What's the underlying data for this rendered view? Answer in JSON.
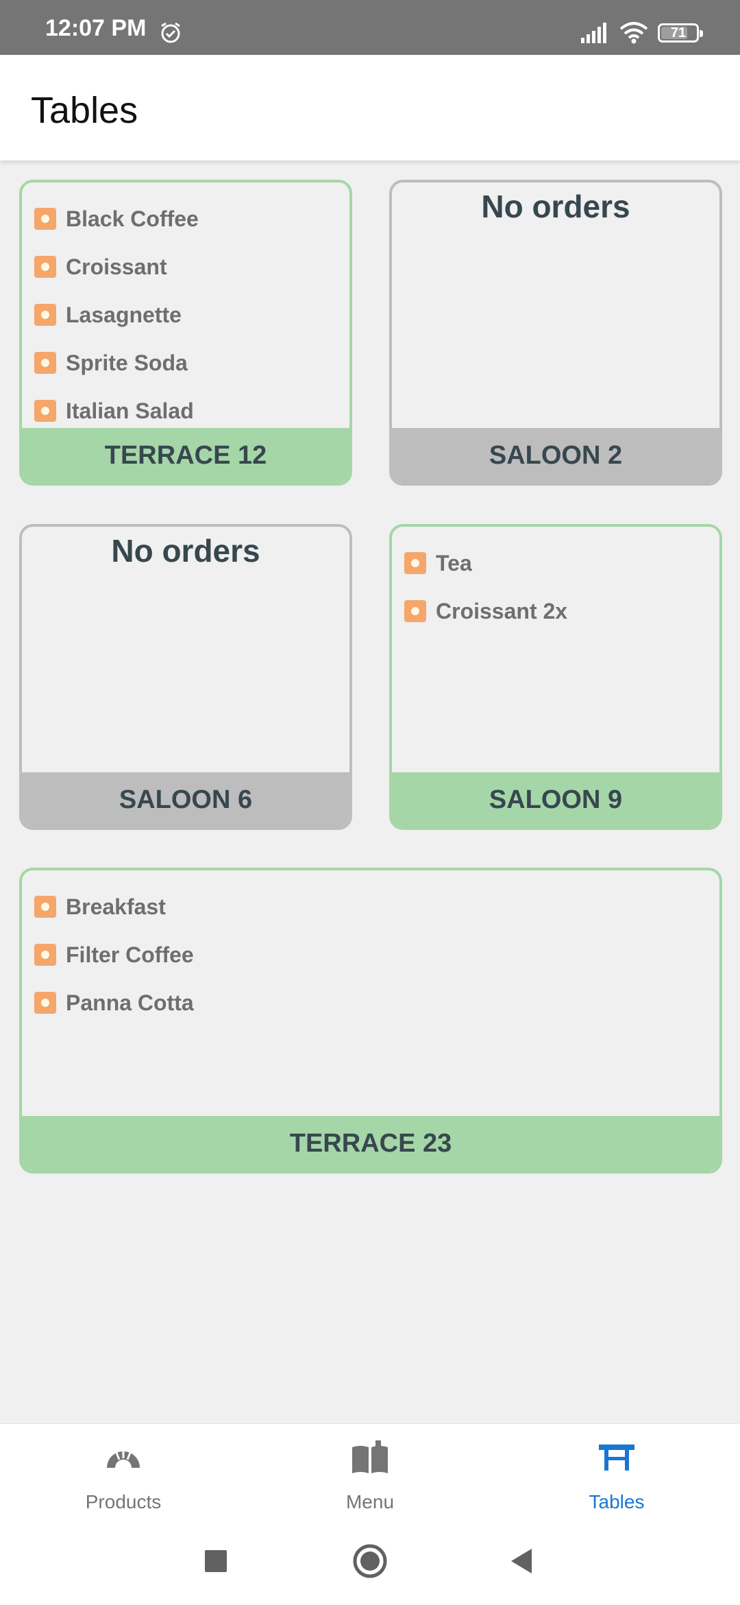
{
  "status_bar": {
    "time": "12:07 PM",
    "battery_level": "71"
  },
  "app_bar": {
    "title": "Tables"
  },
  "tables": [
    {
      "name": "TERRACE 12",
      "status": "busy",
      "orders": [
        "Black Coffee",
        "Croissant",
        "Lasagnette",
        "Sprite Soda",
        "Italian Salad"
      ]
    },
    {
      "name": "SALOON 2",
      "status": "free",
      "empty_text": "No orders",
      "orders": []
    },
    {
      "name": "SALOON 6",
      "status": "free",
      "empty_text": "No orders",
      "orders": []
    },
    {
      "name": "SALOON 9",
      "status": "busy",
      "orders": [
        "Tea",
        "Croissant 2x"
      ]
    },
    {
      "name": "TERRACE 23",
      "status": "busy",
      "orders": [
        "Breakfast",
        "Filter Coffee",
        "Panna Cotta"
      ]
    }
  ],
  "bottom_nav": {
    "items": [
      {
        "label": "Products",
        "icon": "products-icon",
        "active": false
      },
      {
        "label": "Menu",
        "icon": "menu-book-icon",
        "active": false
      },
      {
        "label": "Tables",
        "icon": "table-icon",
        "active": true
      }
    ]
  },
  "colors": {
    "busy": "#a5d6a7",
    "free": "#bdbdbd",
    "accent": "#1976d2",
    "order_icon": "#f5a668"
  }
}
